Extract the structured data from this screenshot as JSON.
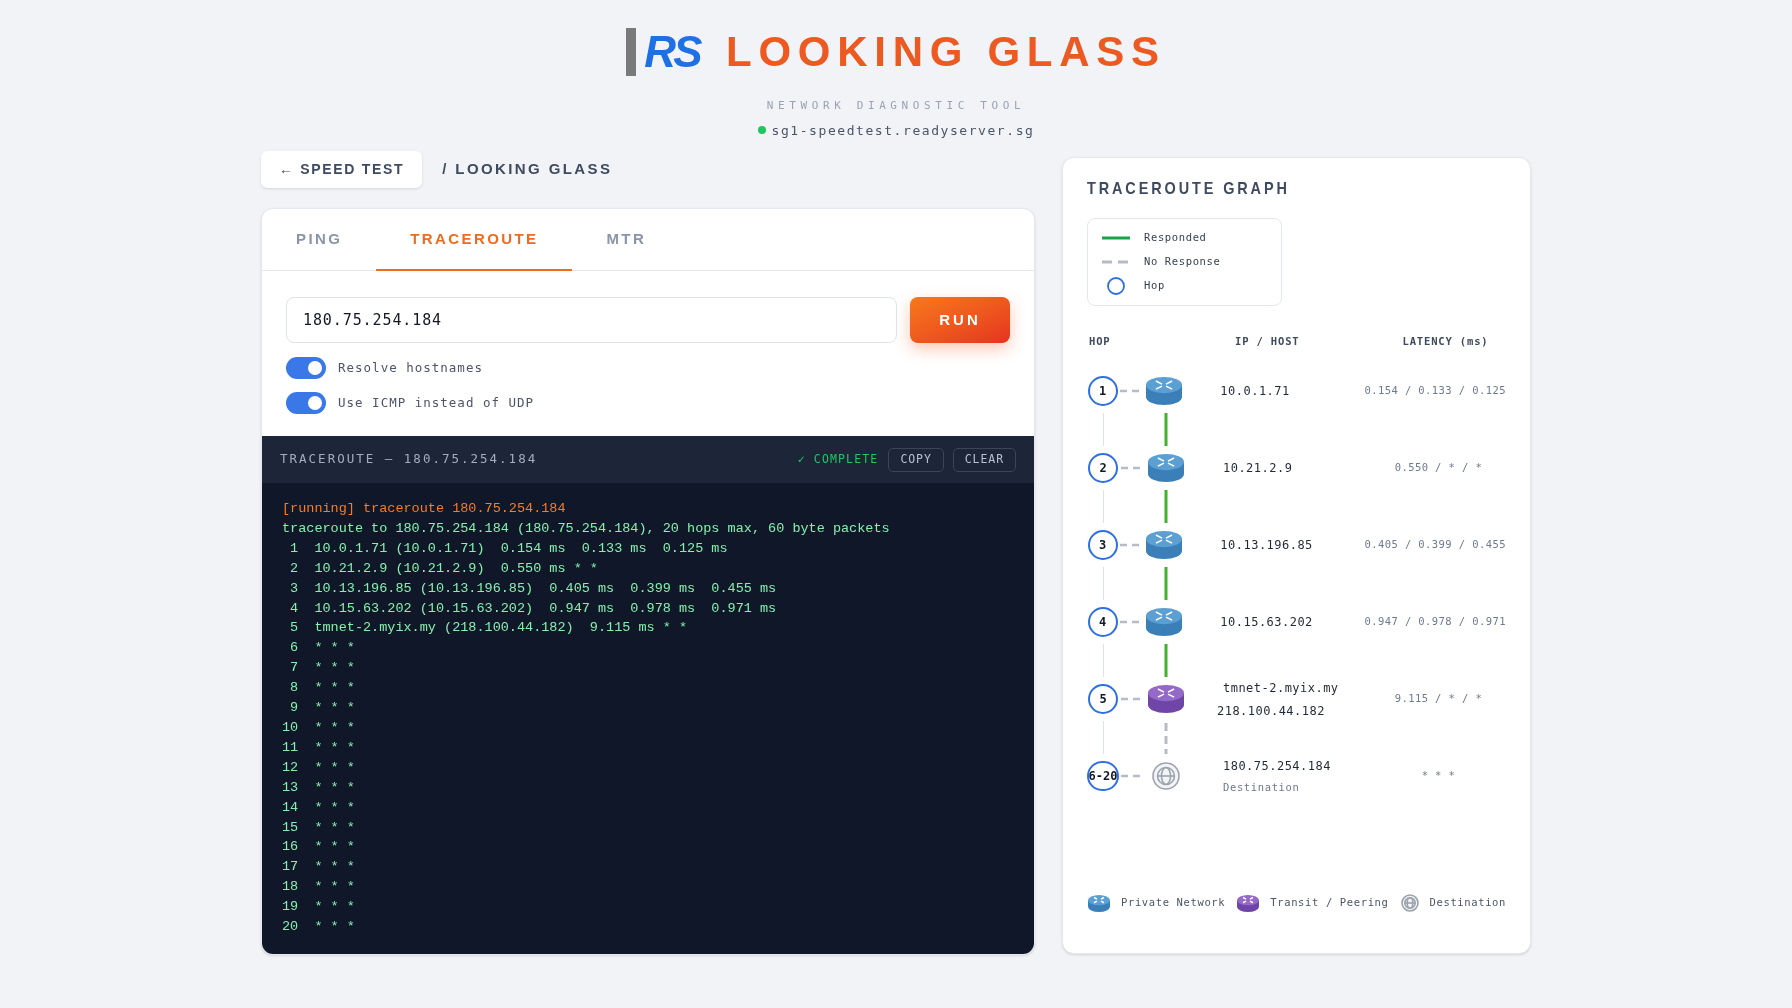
{
  "header": {
    "logo": "RS",
    "title": "LOOKING GLASS",
    "subtitle": "NETWORK DIAGNOSTIC TOOL",
    "server": {
      "host": "sg1-speedtest.readyserver.sg",
      "online": true
    }
  },
  "breadcrumb": {
    "back": "← SPEED TEST",
    "current": "/ LOOKING GLASS"
  },
  "tabs": [
    {
      "label": "PING",
      "selected": false
    },
    {
      "label": "TRACEROUTE",
      "selected": true
    },
    {
      "label": "MTR",
      "selected": false
    }
  ],
  "target": {
    "value": "180.75.254.184"
  },
  "run_button": "RUN",
  "options": [
    {
      "label": "Resolve hostnames",
      "on": true
    },
    {
      "label": "Use ICMP instead of UDP",
      "on": true
    }
  ],
  "terminal": {
    "title": "TRACEROUTE — 180.75.254.184",
    "status": "✓ COMPLETE",
    "buttons": [
      "COPY",
      "CLEAR"
    ],
    "lines": [
      {
        "kind": "command",
        "text": "[running] traceroute 180.75.254.184"
      },
      {
        "kind": "output",
        "text": "traceroute to 180.75.254.184 (180.75.254.184), 20 hops max, 60 byte packets"
      },
      {
        "kind": "output",
        "text": " 1  10.0.1.71 (10.0.1.71)  0.154 ms  0.133 ms  0.125 ms"
      },
      {
        "kind": "output",
        "text": " 2  10.21.2.9 (10.21.2.9)  0.550 ms * *"
      },
      {
        "kind": "output",
        "text": " 3  10.13.196.85 (10.13.196.85)  0.405 ms  0.399 ms  0.455 ms"
      },
      {
        "kind": "output",
        "text": " 4  10.15.63.202 (10.15.63.202)  0.947 ms  0.978 ms  0.971 ms"
      },
      {
        "kind": "output",
        "text": " 5  tmnet-2.myix.my (218.100.44.182)  9.115 ms * *"
      },
      {
        "kind": "output",
        "text": " 6  * * *"
      },
      {
        "kind": "output",
        "text": " 7  * * *"
      },
      {
        "kind": "output",
        "text": " 8  * * *"
      },
      {
        "kind": "output",
        "text": " 9  * * *"
      },
      {
        "kind": "output",
        "text": "10  * * *"
      },
      {
        "kind": "output",
        "text": "11  * * *"
      },
      {
        "kind": "output",
        "text": "12  * * *"
      },
      {
        "kind": "output",
        "text": "13  * * *"
      },
      {
        "kind": "output",
        "text": "14  * * *"
      },
      {
        "kind": "output",
        "text": "15  * * *"
      },
      {
        "kind": "output",
        "text": "16  * * *"
      },
      {
        "kind": "output",
        "text": "17  * * *"
      },
      {
        "kind": "output",
        "text": "18  * * *"
      },
      {
        "kind": "output",
        "text": "19  * * *"
      },
      {
        "kind": "output",
        "text": "20  * * *"
      }
    ]
  },
  "graph": {
    "title": "TRACEROUTE GRAPH",
    "legend": [
      {
        "kind": "line",
        "label": "Responded"
      },
      {
        "kind": "dashed",
        "label": "No Response"
      },
      {
        "kind": "circle",
        "label": "Hop"
      }
    ],
    "columns": [
      "HOP",
      "IP / HOST",
      "LATENCY (ms)"
    ],
    "hops": [
      {
        "hop": "1",
        "kind": "private",
        "host": "10.0.1.71",
        "latency": "0.154 / 0.133 / 0.125",
        "responded": true
      },
      {
        "hop": "2",
        "kind": "private",
        "host": "10.21.2.9",
        "latency": "0.550 / * / *",
        "responded": true
      },
      {
        "hop": "3",
        "kind": "private",
        "host": "10.13.196.85",
        "latency": "0.405 / 0.399 / 0.455",
        "responded": true
      },
      {
        "hop": "4",
        "kind": "private",
        "host": "10.15.63.202",
        "latency": "0.947 / 0.978 / 0.971",
        "responded": true
      },
      {
        "hop": "5",
        "kind": "transit",
        "host": "tmnet-2.myix.my",
        "ip": "218.100.44.182",
        "latency": "9.115 / * / *",
        "responded": false
      },
      {
        "hop": "6-20",
        "kind": "destination",
        "host": "180.75.254.184",
        "note": "Destination",
        "latency": "* * *"
      }
    ],
    "device_legend": [
      {
        "kind": "private",
        "label": "Private Network"
      },
      {
        "kind": "transit",
        "label": "Transit / Peering"
      },
      {
        "kind": "destination",
        "label": "Destination"
      }
    ]
  }
}
